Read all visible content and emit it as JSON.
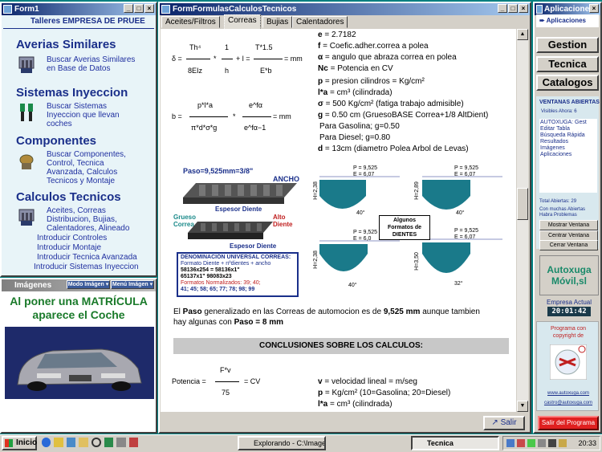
{
  "form1": {
    "title": "Form1",
    "header": "Talleres EMPRESA DE PRUEE",
    "sections": [
      {
        "title": "Averias Similares",
        "links": [
          "Buscar Averias Similares",
          "en Base de Datos"
        ]
      },
      {
        "title": "Sistemas Inyeccion",
        "links": [
          "Buscar Sistemas",
          "Inyeccion que llevan",
          "coches"
        ]
      },
      {
        "title": "Componentes",
        "links": [
          "Buscar Componentes,",
          "Control, Tecnica",
          "Avanzada, Calculos",
          "Tecnicos y Montaje"
        ]
      },
      {
        "title": "Calculos Tecnicos",
        "links": [
          "Aceites, Correas",
          "Distribucion, Bujias,",
          "Calentadores, Alineado",
          "Introducir Controles",
          "Introducir Montaje",
          "Introducir Tecnica Avanzada",
          "Introducir Sistemas Inyeccion"
        ]
      }
    ]
  },
  "imagenes": {
    "title": "Imágenes",
    "modo": "Modo Imágen",
    "menu": "Menú Imágen",
    "caption": "Al poner una MATRÍCULA aparece el Coche"
  },
  "formulas": {
    "title": "FormFormulasCalculosTecnicos",
    "tabs": [
      "Aceites/Filtros",
      "Correas",
      "Bujias",
      "Calentadores"
    ],
    "active_tab": "Correas",
    "salir": "Salir"
  },
  "doc": {
    "eq1": {
      "lhs": "δ =",
      "n1": "Th⁴",
      "d1": "8EIz",
      "op1": "*",
      "n2": "1",
      "d2": "h",
      "op2": "+ l =",
      "n3": "T*1.5",
      "d3": "E*b",
      "unit": "= mm"
    },
    "eq2": {
      "lhs": "b =",
      "n1": "p*l*a",
      "d1": "π*d*σ*g",
      "op": "*",
      "n2": "e^fα",
      "d2": "e^fα−1",
      "unit": "= mm"
    },
    "defs": [
      {
        "s": "e",
        "t": " = 2.7182"
      },
      {
        "s": "f",
        "t": " = Coefic.adher.correa a polea"
      },
      {
        "s": "α",
        "t": " = angulo que abraza correa en polea"
      },
      {
        "s": "Nc",
        "t": " = Potencia en CV"
      },
      {
        "s": "p",
        "t": " = presion cilindros = Kg/cm²"
      },
      {
        "s": "l*a",
        "t": " = cm³ (cilindrada)"
      },
      {
        "s": "σ",
        "t": " = 500 Kg/cm² (fatiga trabajo admisible)"
      },
      {
        "s": "g",
        "t": " = 0.50 cm (GruesoBASE Correa+1/8 AltDient)"
      },
      {
        "s": "",
        "t": "Para Gasolina; g=0.50"
      },
      {
        "s": "",
        "t": "Para Diesel; g=0.80"
      },
      {
        "s": "d",
        "t": " = 13cm (diametro Polea Arbol de Levas)"
      }
    ],
    "diagram": {
      "paso": "Paso=9,525mm=3/8\"",
      "ancho": "ANCHO",
      "espesor": "Espesor Diente",
      "grueso": "Grueso Correa",
      "alto": "Alto Diente",
      "espesor2": "Espesor Diente",
      "denom_title": "DENOMINACIÓN UNIVERSAL CORREAS:",
      "denom_line": "Formato Diente + nºdientes + ancho",
      "denom_ex1": "58136x254 = 58136x1\"",
      "denom_ex2": "65137x1\"     98083x23",
      "denom_norm": "Formatos Normalizados: 39; 40;",
      "denom_list": "41; 45; 58; 65; 77; 78; 98; 99",
      "formatos": "Algunos Formatos de DIENTES",
      "profiles": [
        {
          "p": "P = 9,525",
          "e": "E = 6,07",
          "h": "H=2,38",
          "a": "40°"
        },
        {
          "p": "P = 9,525",
          "e": "E = 6,07",
          "h": "H=2,89",
          "a": "40°"
        },
        {
          "p": "P = 9,525",
          "e": "E = 6,0",
          "h": "H=2,38",
          "a": "40°"
        },
        {
          "p": "P = 9,525",
          "e": "E = 6,07",
          "h": "H=3,50",
          "a": "32°"
        }
      ]
    },
    "paso_text": [
      "El ",
      "Paso",
      " generalizado en las Correas de automocion es de ",
      "9,525 mm",
      " aunque tambien",
      "hay algunas con ",
      "Paso = 8 mm"
    ],
    "conclusiones": "CONCLUSIONES SOBRE LOS CALCULOS:",
    "eq3": {
      "lhs": "Potencia =",
      "n": "F*v",
      "d": "75",
      "unit": "= CV"
    },
    "defs2": [
      {
        "s": "v",
        "t": " = velocidad lineal = m/seg"
      },
      {
        "s": "p",
        "t": " = Kg/cm² (10=Gasolina; 20=Diesel)"
      },
      {
        "s": "l*a",
        "t": " = cm³ (cilindrada)"
      }
    ]
  },
  "aplic": {
    "title": "Aplicaciones",
    "head": "Aplicaciones",
    "gestion": "Gestion",
    "tecnica": "Tecnica",
    "catalogos": "Catalogos",
    "ventanas_title": "VENTANAS ABIERTAS",
    "visibles": "Visibles Ahora: 6",
    "list": [
      "AUTOXUGA: Gest",
      "Editar Tabla",
      "Búsqueda Rápida",
      "Resultados",
      "Imágenes",
      "Aplicaciones"
    ],
    "total": "Total Abiertas: 29",
    "aviso": "Con muchas Abiertas Habra Problemas",
    "mostrar": "Mostrar Ventana",
    "centrar1": "Centrar Ventana",
    "cerrar": "Cerrar Ventana",
    "brand": "Autoxuga Móvil,sl",
    "empresa": "Empresa Actual",
    "clock": "20:01:42",
    "programa": "Programa con copyright de",
    "web": "www.autoxuga.com",
    "mail": "castro@autoxuga.com",
    "salir": "Salir del Programa"
  },
  "taskbar": {
    "inicio": "Inicio",
    "items": [
      "Explorando - C:\\Imagen...",
      "Tecnica"
    ],
    "time": "20:33"
  }
}
